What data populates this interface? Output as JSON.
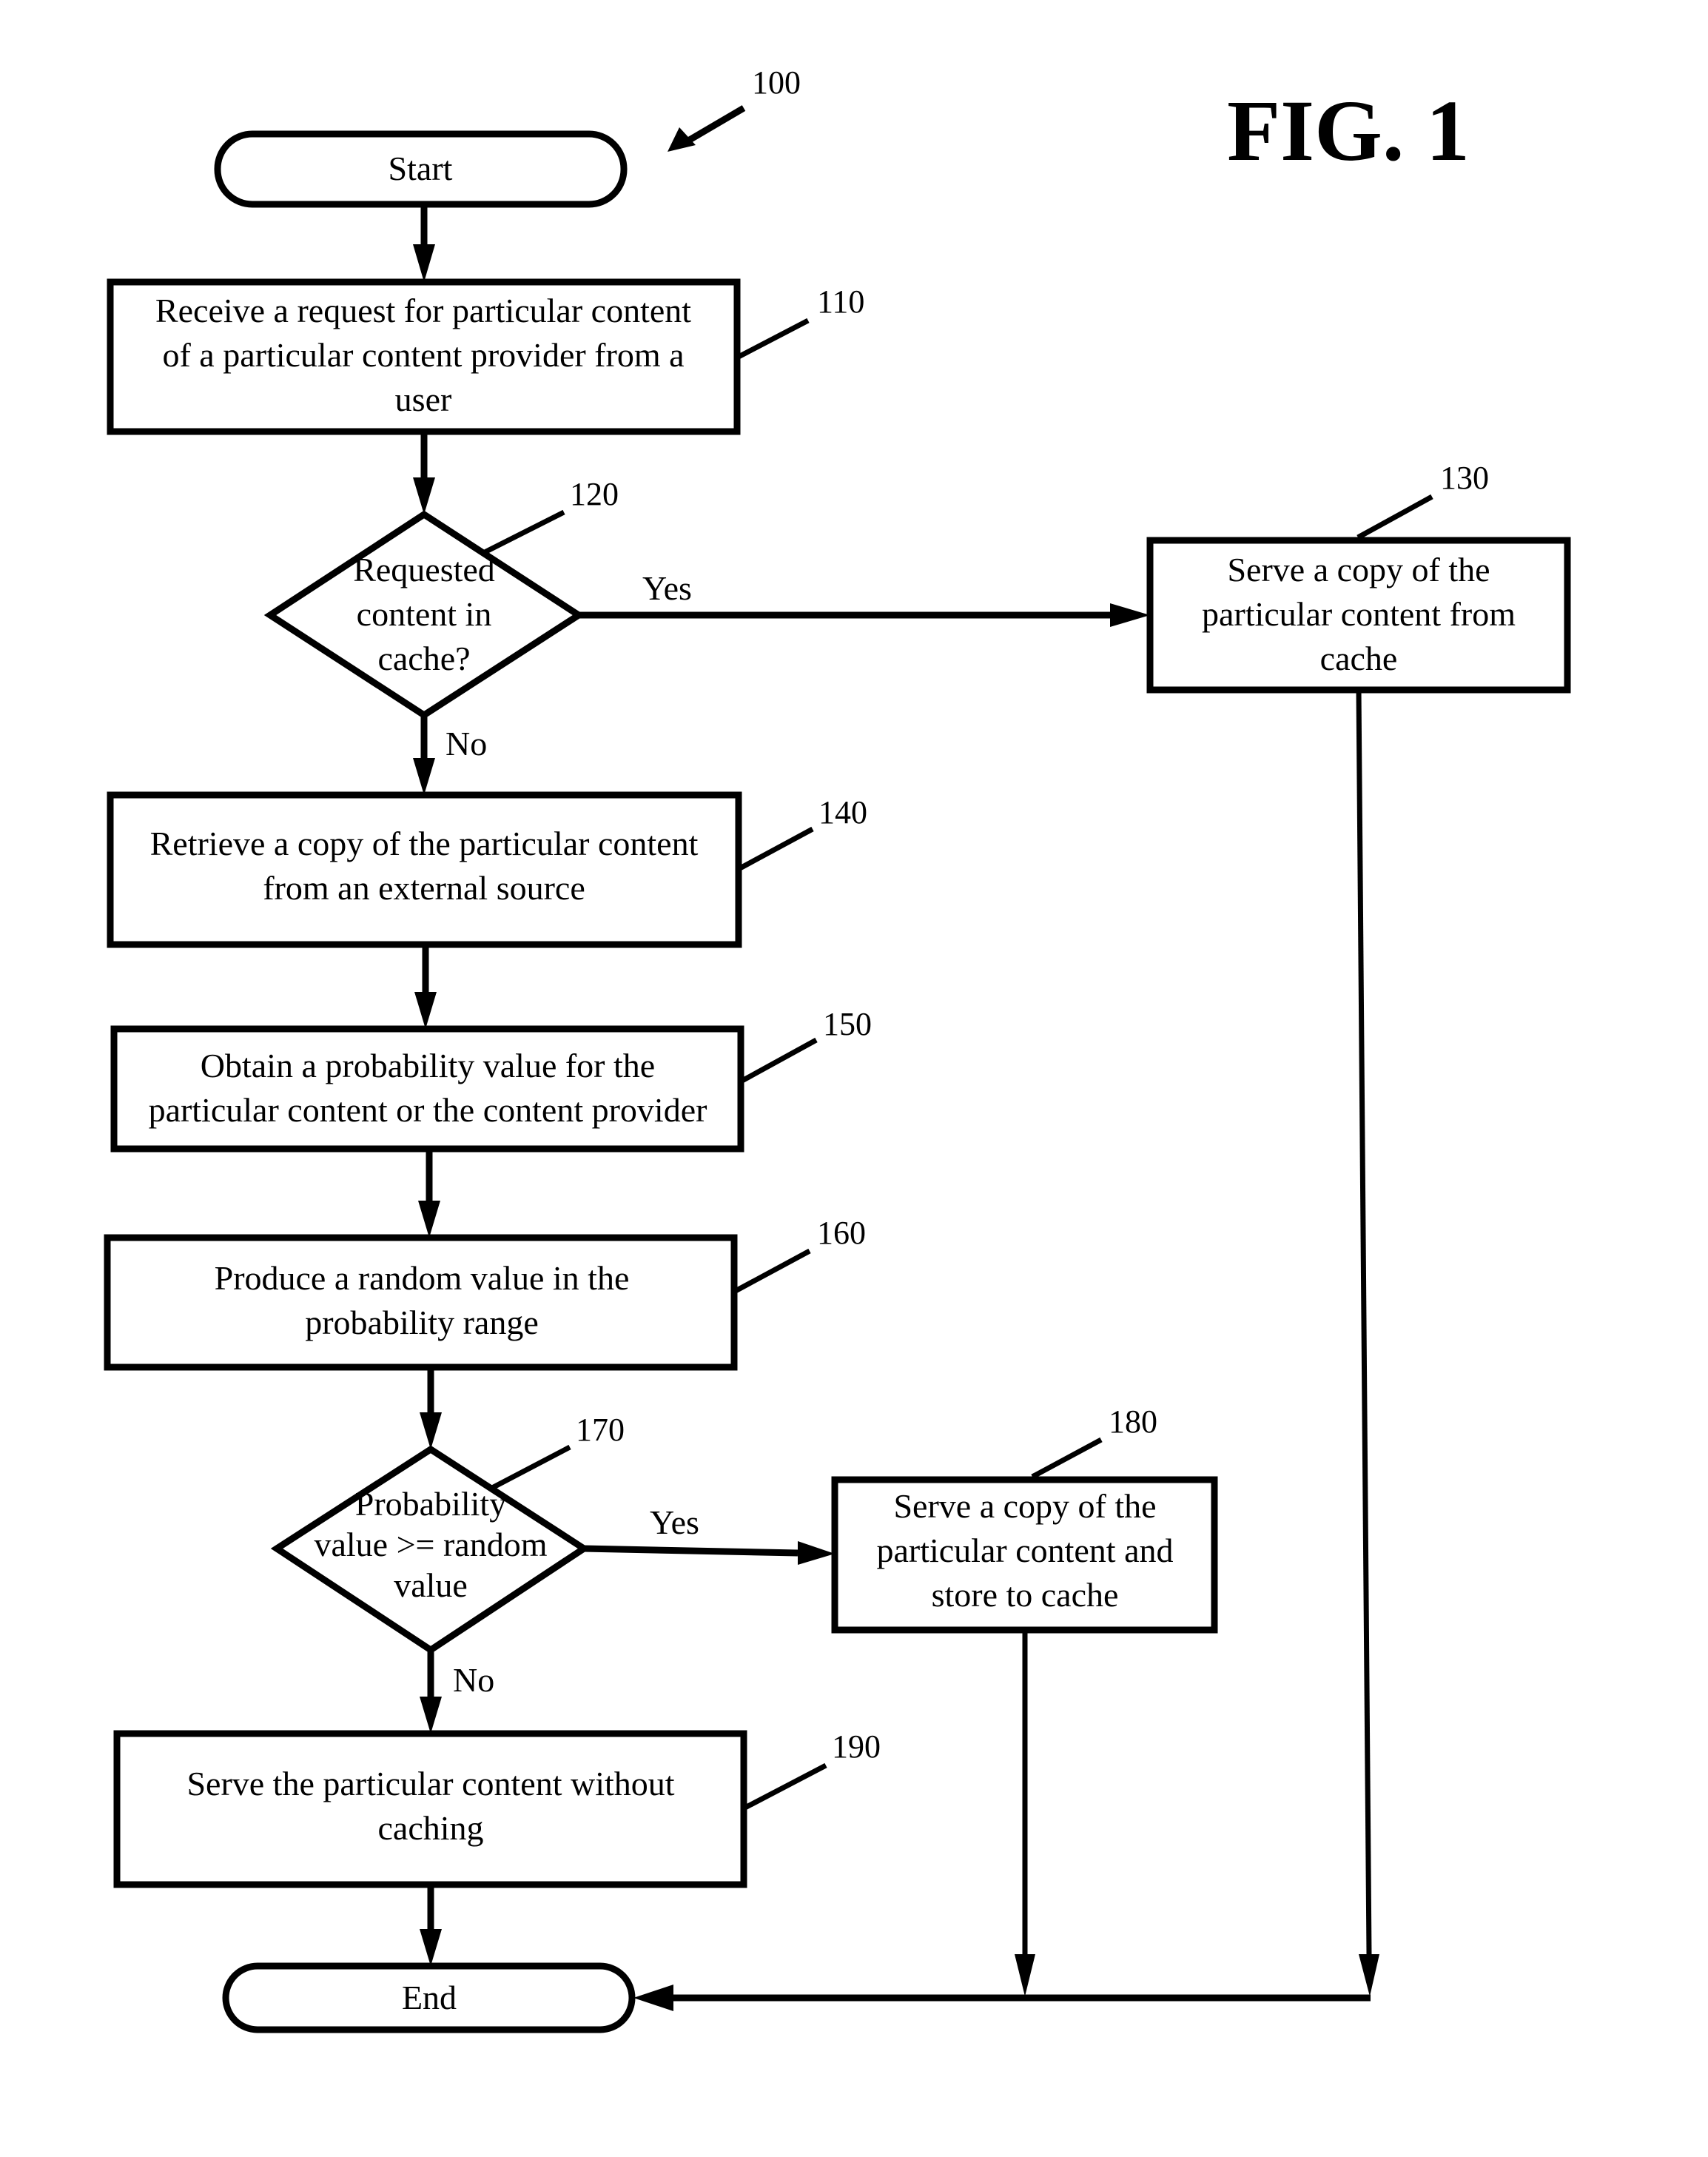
{
  "figure": {
    "title": "FIG. 1",
    "reference": "100"
  },
  "nodes": {
    "start": {
      "label": "Start"
    },
    "n110": {
      "ref": "110",
      "lines": [
        "Receive a request for particular content",
        "of a particular content provider from a",
        "user"
      ]
    },
    "n120": {
      "ref": "120",
      "lines": [
        "Requested",
        "content in",
        "cache?"
      ]
    },
    "n130": {
      "ref": "130",
      "lines": [
        "Serve a copy of the",
        "particular content from",
        "cache"
      ]
    },
    "n140": {
      "ref": "140",
      "lines": [
        "Retrieve a copy of the particular content",
        "from an external source"
      ]
    },
    "n150": {
      "ref": "150",
      "lines": [
        "Obtain a probability value for the",
        "particular content or the content provider"
      ]
    },
    "n160": {
      "ref": "160",
      "lines": [
        "Produce a random value in the",
        "probability range"
      ]
    },
    "n170": {
      "ref": "170",
      "lines": [
        "Probability",
        "value >= random",
        "value"
      ]
    },
    "n180": {
      "ref": "180",
      "lines": [
        "Serve a copy of the",
        "particular content and",
        "store to cache"
      ]
    },
    "n190": {
      "ref": "190",
      "lines": [
        "Serve the particular content without",
        "caching"
      ]
    },
    "end": {
      "label": "End"
    }
  },
  "edges": {
    "d120_yes": "Yes",
    "d120_no": "No",
    "d170_yes": "Yes",
    "d170_no": "No"
  }
}
